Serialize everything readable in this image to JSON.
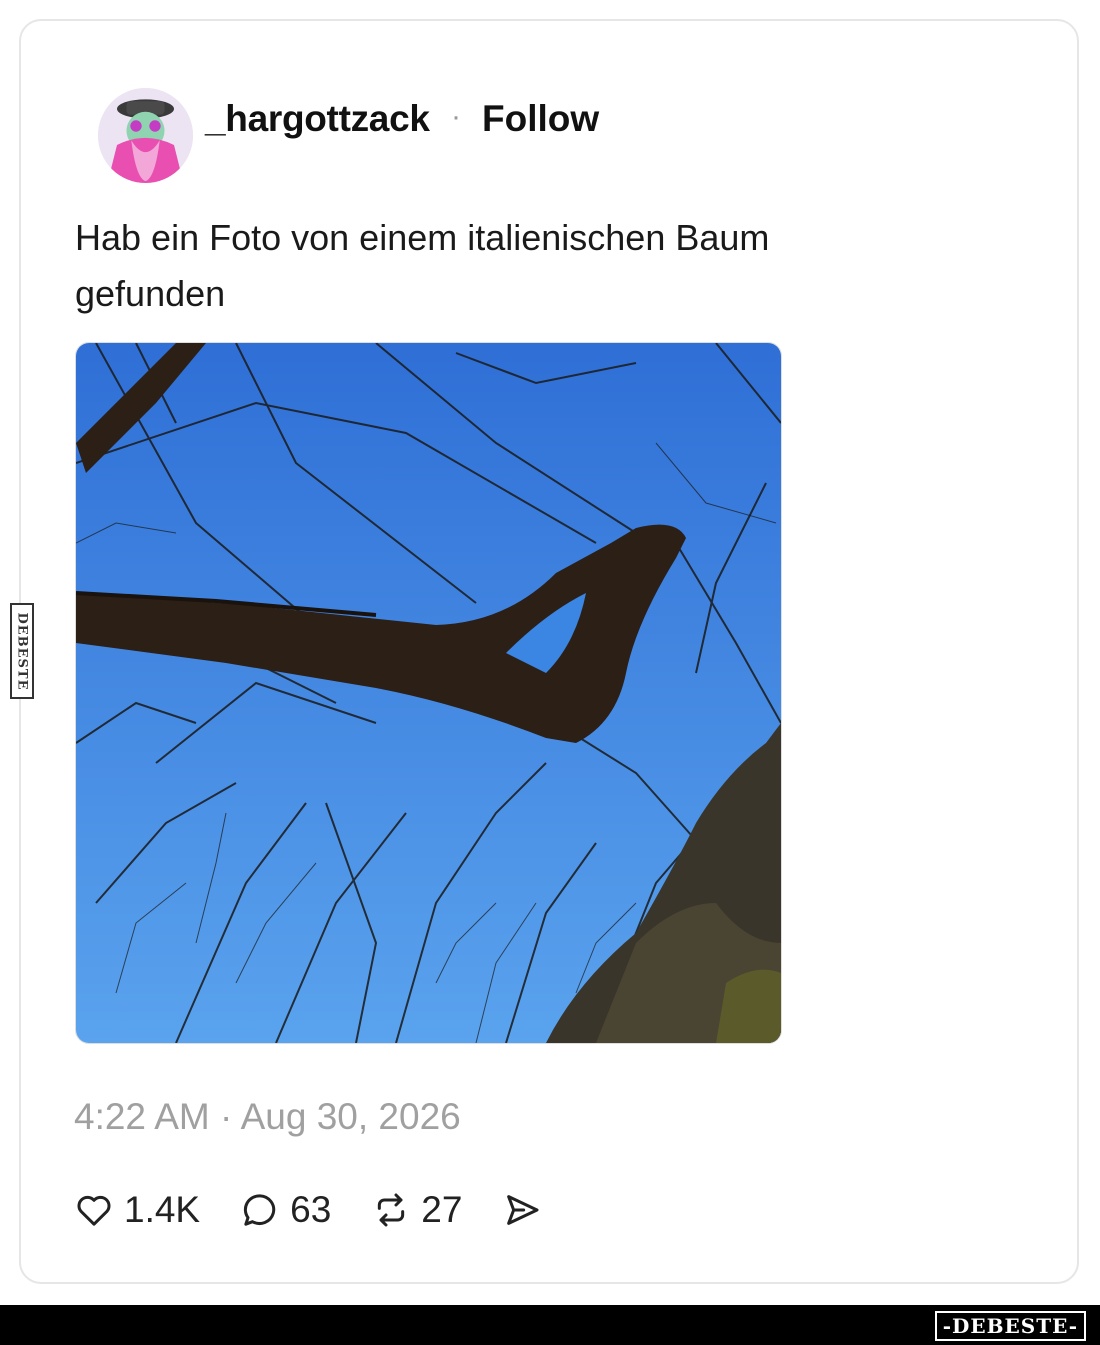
{
  "post": {
    "username": "_hargottzack",
    "separator": "·",
    "follow_label": "Follow",
    "text": "Hab ein Foto von einem italienischen Baum gefunden",
    "timestamp": "4:22 AM · Aug 30, 2026"
  },
  "actions": {
    "likes": "1.4K",
    "comments": "63",
    "reposts": "27"
  },
  "icons": {
    "like": "heart-icon",
    "comment": "comment-bubble-icon",
    "repost": "repost-icon",
    "share": "send-icon"
  },
  "watermark": {
    "logo_text": "-DEBESTE-",
    "side_text": "DEBESTE"
  },
  "colors": {
    "sky": "#3d82e0",
    "text_muted": "#a0a0a0",
    "card_border": "#e6e6e6"
  }
}
